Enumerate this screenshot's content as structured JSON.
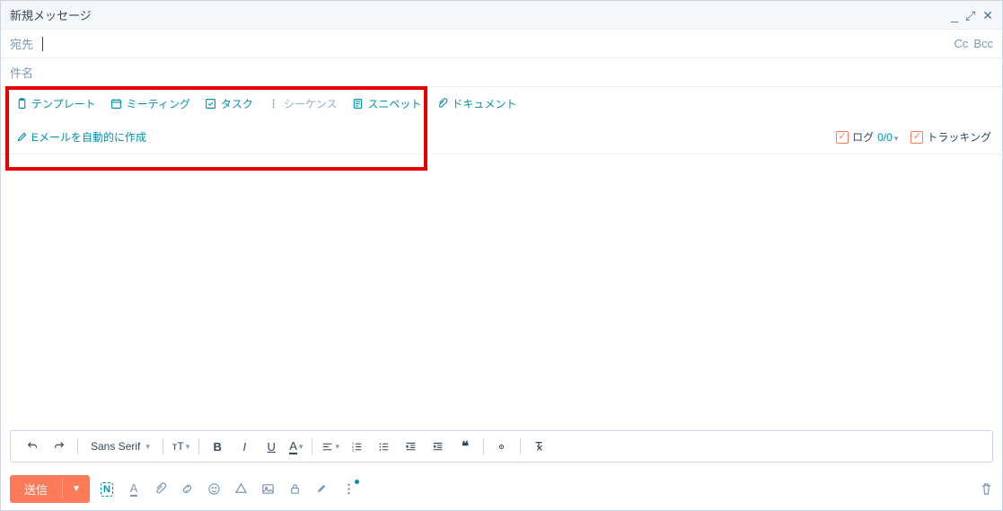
{
  "header": {
    "title": "新規メッセージ"
  },
  "to": {
    "label": "宛先",
    "cc": "Cc",
    "bcc": "Bcc"
  },
  "subject": {
    "label": "件名"
  },
  "tools": {
    "template": "テンプレート",
    "meeting": "ミーティング",
    "task": "タスク",
    "sequence": "シーケンス",
    "snippet": "スニペット",
    "document": "ドキュメント",
    "autogen": "Eメールを自動的に作成"
  },
  "right": {
    "log_label": "ログ",
    "log_count": "0/0",
    "tracking_label": "トラッキング"
  },
  "format": {
    "font": "Sans Serif"
  },
  "footer": {
    "send": "送信"
  }
}
